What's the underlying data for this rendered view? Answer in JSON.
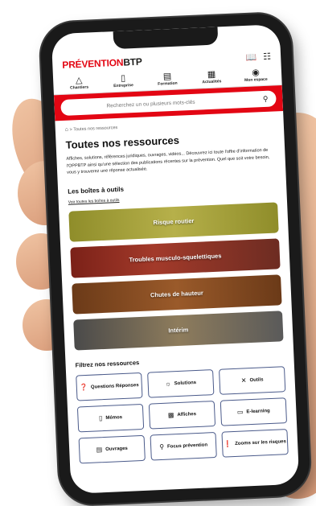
{
  "header": {
    "logo_part1": "PRÉVENTION",
    "logo_part2": "BTP",
    "icon_book": "book-icon",
    "icon_filter": "filter-icon"
  },
  "nav": {
    "items": [
      {
        "label": "Chantiers",
        "icon": "hard-hat-icon"
      },
      {
        "label": "Entreprise",
        "icon": "building-icon"
      },
      {
        "label": "Formation",
        "icon": "monitor-icon"
      },
      {
        "label": "Actualités",
        "icon": "news-icon"
      },
      {
        "label": "Mon espace",
        "icon": "user-icon"
      }
    ]
  },
  "search": {
    "placeholder": "Recherchez un ou plusieurs mots-clés"
  },
  "breadcrumb": {
    "current": "Toutes nos ressources"
  },
  "page": {
    "title": "Toutes nos ressources",
    "intro": "Affiches, solutions, références juridiques, ouvrages, vidéos... Découvrez ici toute l'offre d'information de l'OPPBTP ainsi qu'une sélection des publications récentes sur la prévention. Quel que soit votre besoin, vous y trouverez une réponse actualisée."
  },
  "toolboxes": {
    "heading": "Les boîtes à outils",
    "see_all": "Voir toutes les boîtes à outils",
    "cards": [
      {
        "label": "Risque routier"
      },
      {
        "label": "Troubles musculo-squelettiques"
      },
      {
        "label": "Chutes de hauteur"
      },
      {
        "label": "Intérim"
      }
    ]
  },
  "filters": {
    "heading": "Filtrez nos ressources",
    "items": [
      {
        "label": "Questions Réponses",
        "icon": "question-icon"
      },
      {
        "label": "Solutions",
        "icon": "lightbulb-icon"
      },
      {
        "label": "Outils",
        "icon": "tools-icon"
      },
      {
        "label": "Mémos",
        "icon": "memo-icon"
      },
      {
        "label": "Affiches",
        "icon": "poster-icon"
      },
      {
        "label": "E-learning",
        "icon": "laptop-icon"
      },
      {
        "label": "Ouvrages",
        "icon": "open-book-icon"
      },
      {
        "label": "Focus prévention",
        "icon": "search-icon"
      },
      {
        "label": "Zooms sur les risques",
        "icon": "alert-icon"
      }
    ]
  }
}
